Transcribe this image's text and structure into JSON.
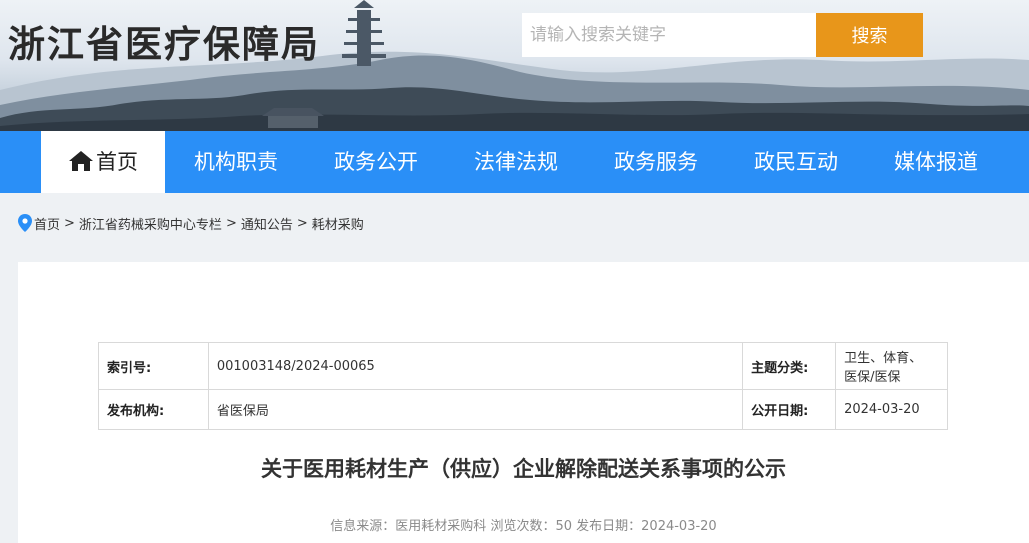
{
  "header": {
    "site_title": "浙江省医疗保障局",
    "search_placeholder": "请输入搜索关键字",
    "search_button": "搜索"
  },
  "nav": {
    "items": [
      {
        "label": "首页",
        "active": true
      },
      {
        "label": "机构职责"
      },
      {
        "label": "政务公开"
      },
      {
        "label": "法律法规"
      },
      {
        "label": "政务服务"
      },
      {
        "label": "政民互动"
      },
      {
        "label": "媒体报道"
      }
    ]
  },
  "breadcrumb": {
    "items": [
      "首页",
      "浙江省药械采购中心专栏",
      "通知公告",
      "耗材采购"
    ],
    "separator": ">"
  },
  "meta": {
    "index_label": "索引号:",
    "index_value": "001003148/2024-00065",
    "topic_label": "主题分类:",
    "topic_value_line1": "卫生、体育、",
    "topic_value_line2": "医保/医保",
    "publisher_label": "发布机构:",
    "publisher_value": "省医保局",
    "public_date_label": "公开日期:",
    "public_date_value": "2024-03-20"
  },
  "article": {
    "title": "关于医用耗材生产（供应）企业解除配送关系事项的公示",
    "source_label": "信息来源：",
    "source_value": "医用耗材采购科",
    "views_label": "浏览次数：",
    "views_value": "50",
    "date_label": "发布日期：",
    "date_value": "2024-03-20"
  },
  "colors": {
    "nav_bg": "#2a8ff7",
    "search_button": "#e8961a"
  }
}
